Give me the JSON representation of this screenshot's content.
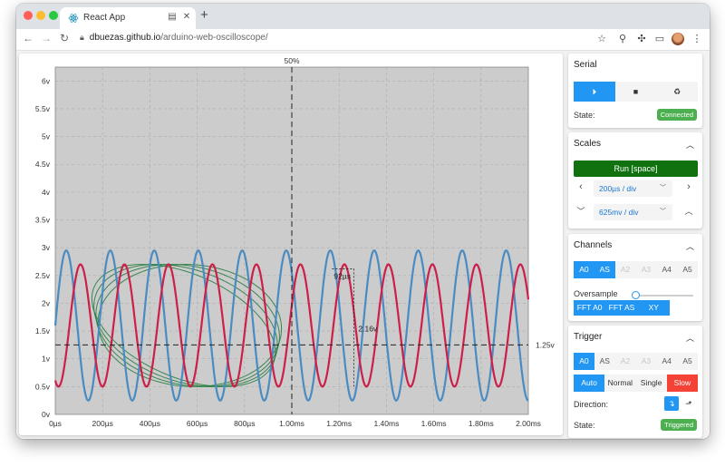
{
  "browser": {
    "tab_title": "React App",
    "url_domain": "dbuezas.github.io",
    "url_path": "/arduino-web-oscilloscope/",
    "icons": [
      "back-icon",
      "forward-icon",
      "reload-icon",
      "lock-icon",
      "star-icon",
      "search-icon",
      "extensions-icon",
      "cast-icon",
      "profile-avatar",
      "menu-icon"
    ]
  },
  "scope": {
    "trigger_position_label": "50%",
    "trigger_level_label": "1.25v",
    "time_measure_label": "92µs",
    "voltage_measure_label": "2.16v",
    "colors": {
      "plot_bg": "#cccccc",
      "a0": "#cc1f4a",
      "as": "#4a8cc2",
      "xy": "#1e7a3a"
    },
    "chart_data": {
      "type": "line",
      "ylim": [
        0,
        6.25
      ],
      "xlim_ms": [
        0,
        2.0
      ],
      "y_ticks": [
        "0v",
        "0.5v",
        "1v",
        "1.5v",
        "2v",
        "2.5v",
        "3v",
        "3.5v",
        "4v",
        "4.5v",
        "5v",
        "5.5v",
        "6v"
      ],
      "x_ticks": [
        "0µs",
        "200µs",
        "400µs",
        "600µs",
        "800µs",
        "1.00ms",
        "1.20ms",
        "1.40ms",
        "1.60ms",
        "1.80ms",
        "2.00ms"
      ],
      "trigger_level_v": 1.25,
      "trigger_time_ms": 1.0,
      "series": [
        {
          "id": "A0",
          "min_v": 0.5,
          "max_v": 2.7,
          "period_ms": 0.186,
          "phase_ms": 0.06
        },
        {
          "id": "AS",
          "min_v": 0.25,
          "max_v": 2.95,
          "period_ms": 0.186,
          "phase_ms": 0.0
        }
      ]
    }
  },
  "serial": {
    "title": "Serial",
    "buttons": [
      "⏵",
      "■",
      "♻"
    ],
    "state_label": "State:",
    "state_value": "Connected"
  },
  "scales": {
    "title": "Scales",
    "run_label": "Run [space]",
    "time_div": "200µs / div",
    "volt_div": "625mv / div"
  },
  "channels": {
    "title": "Channels",
    "items": [
      "A0",
      "AS",
      "A2",
      "A3",
      "A4",
      "A5"
    ],
    "oversample_label": "Oversample",
    "oversample_value": 0,
    "fft_buttons": [
      "FFT A0",
      "FFT AS",
      "XY"
    ]
  },
  "trigger": {
    "title": "Trigger",
    "channels": [
      "A0",
      "AS",
      "A2",
      "A3",
      "A4",
      "A5"
    ],
    "modes": [
      "Auto",
      "Normal",
      "Single",
      "Slow"
    ],
    "direction_label": "Direction:",
    "state_label": "State:",
    "state_value": "Triggered"
  }
}
